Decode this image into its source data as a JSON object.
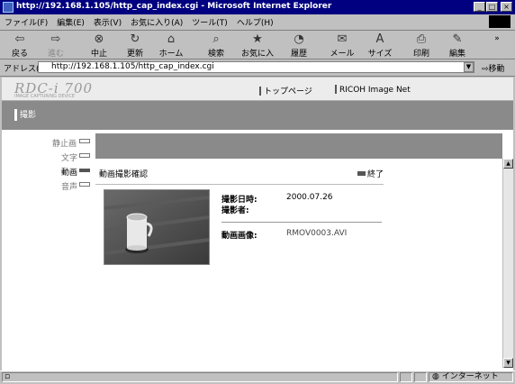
{
  "window": {
    "title": "http://192.168.1.105/http_cap_index.cgi - Microsoft Internet Explorer",
    "min_btn": "_",
    "max_btn": "□",
    "close_btn": "×"
  },
  "menubar": [
    "ファイル(F)",
    "編集(E)",
    "表示(V)",
    "お気に入り(A)",
    "ツール(T)",
    "ヘルプ(H)"
  ],
  "toolbar": {
    "back": "戻る",
    "forward": "進む",
    "stop": "中止",
    "refresh": "更新",
    "home": "ホーム",
    "search": "検索",
    "favorites": "お気に入り",
    "history": "履歴",
    "mail": "メール",
    "size": "サイズ",
    "print": "印刷",
    "edit": "編集",
    "more": "»"
  },
  "addressbar": {
    "label": "アドレス(D)",
    "url": "http://192.168.1.105/http_cap_index.cgi",
    "go": "移動"
  },
  "site": {
    "logo": "RDC-i 700",
    "logo_sub": "IMAGE CAPTURING DEVICE",
    "link_top": "トップページ",
    "link_net": "RICOH Image Net",
    "category": "撮影"
  },
  "nav": [
    {
      "label": "静止画",
      "active": false
    },
    {
      "label": "文字",
      "active": false
    },
    {
      "label": "動画",
      "active": true
    },
    {
      "label": "音声",
      "active": false
    }
  ],
  "content": {
    "subtitle": "動画撮影確認",
    "end_label": "終了",
    "date_label": "撮影日時:",
    "date_value": "2000.07.26",
    "author_label": "撮影者:",
    "author_value": "",
    "file_label": "動画画像:",
    "file_value": "RMOV0003.AVI"
  },
  "status": {
    "zone": "インターネット"
  }
}
